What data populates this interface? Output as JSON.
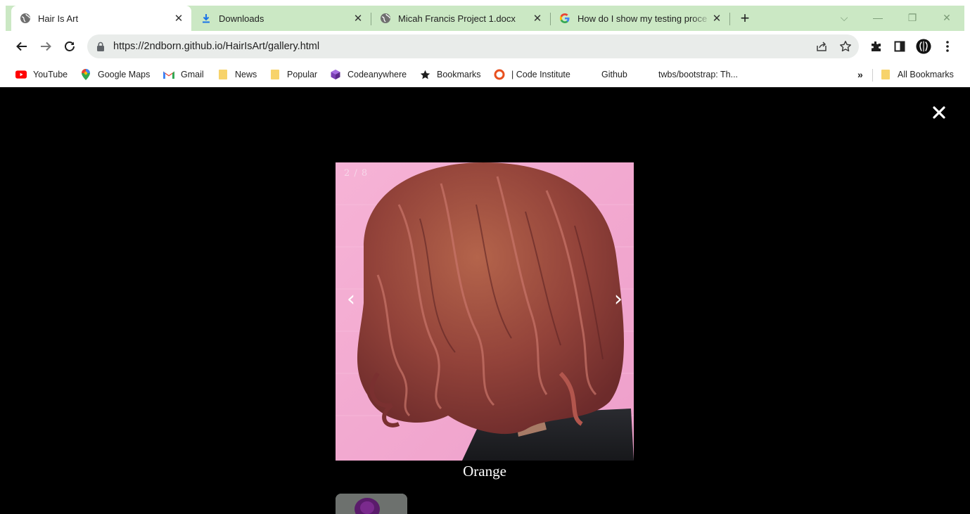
{
  "browser": {
    "tabs": [
      {
        "title": "Hair Is Art",
        "icon": "globe-icon",
        "active": true
      },
      {
        "title": "Downloads",
        "icon": "download-icon",
        "active": false
      },
      {
        "title": "Micah Francis Project 1.docx",
        "icon": "globe-icon",
        "active": false
      },
      {
        "title": "How do I show my testing proce",
        "icon": "google-icon",
        "active": false
      }
    ],
    "url_host": "https://2ndborn.github.io",
    "url_path": "/HairIsArt/gallery.html",
    "bookmarks": [
      {
        "label": "YouTube",
        "icon": "youtube-icon"
      },
      {
        "label": "Google Maps",
        "icon": "maps-pin-icon"
      },
      {
        "label": "Gmail",
        "icon": "gmail-icon"
      },
      {
        "label": "News",
        "icon": "folder-icon"
      },
      {
        "label": "Popular",
        "icon": "folder-icon"
      },
      {
        "label": "Codeanywhere",
        "icon": "cube-icon"
      },
      {
        "label": "Bookmarks",
        "icon": "star-icon"
      },
      {
        "label": "| Code Institute",
        "icon": "ring-icon"
      },
      {
        "label": "Github",
        "icon": ""
      },
      {
        "label": "twbs/bootstrap: Th...",
        "icon": ""
      }
    ],
    "more_bookmarks": "»",
    "all_bookmarks": "All Bookmarks",
    "colors": {
      "tabstrip": "#cbe8c4",
      "omnibox": "#e9ecea"
    }
  },
  "lightbox": {
    "counter": "2 / 8",
    "prev_arrow": "‹",
    "next_arrow": "›",
    "caption": "Orange",
    "close_icon": "close-icon",
    "colors": {
      "backdrop": "#000000",
      "wall": "#f2a9cf",
      "hair": "#9a4535"
    }
  }
}
